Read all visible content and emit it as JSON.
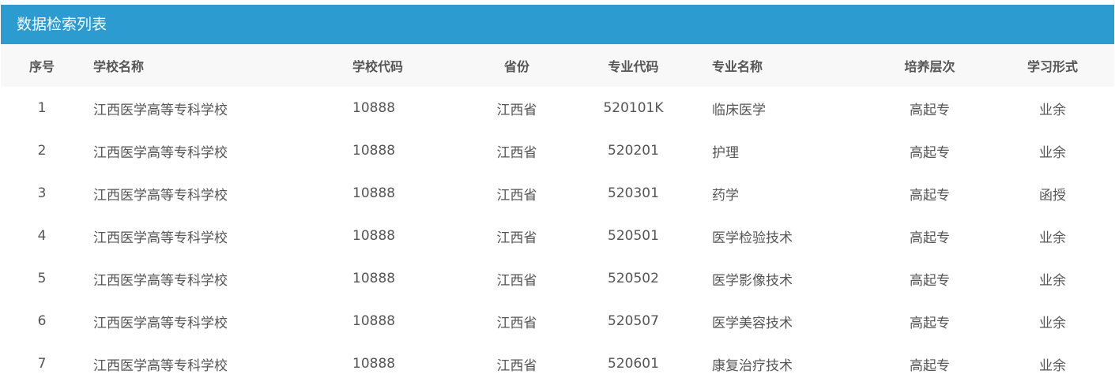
{
  "panel": {
    "title": "数据检索列表"
  },
  "columns": {
    "index": "序号",
    "school_name": "学校名称",
    "school_code": "学校代码",
    "province": "省份",
    "major_code": "专业代码",
    "major_name": "专业名称",
    "level": "培养层次",
    "study_form": "学习形式"
  },
  "rows": [
    {
      "index": "1",
      "school_name": "江西医学高等专科学校",
      "school_code": "10888",
      "province": "江西省",
      "major_code": "520101K",
      "major_name": "临床医学",
      "level": "高起专",
      "study_form": "业余"
    },
    {
      "index": "2",
      "school_name": "江西医学高等专科学校",
      "school_code": "10888",
      "province": "江西省",
      "major_code": "520201",
      "major_name": "护理",
      "level": "高起专",
      "study_form": "业余"
    },
    {
      "index": "3",
      "school_name": "江西医学高等专科学校",
      "school_code": "10888",
      "province": "江西省",
      "major_code": "520301",
      "major_name": "药学",
      "level": "高起专",
      "study_form": "函授"
    },
    {
      "index": "4",
      "school_name": "江西医学高等专科学校",
      "school_code": "10888",
      "province": "江西省",
      "major_code": "520501",
      "major_name": "医学检验技术",
      "level": "高起专",
      "study_form": "业余"
    },
    {
      "index": "5",
      "school_name": "江西医学高等专科学校",
      "school_code": "10888",
      "province": "江西省",
      "major_code": "520502",
      "major_name": "医学影像技术",
      "level": "高起专",
      "study_form": "业余"
    },
    {
      "index": "6",
      "school_name": "江西医学高等专科学校",
      "school_code": "10888",
      "province": "江西省",
      "major_code": "520507",
      "major_name": "医学美容技术",
      "level": "高起专",
      "study_form": "业余"
    },
    {
      "index": "7",
      "school_name": "江西医学高等专科学校",
      "school_code": "10888",
      "province": "江西省",
      "major_code": "520601",
      "major_name": "康复治疗技术",
      "level": "高起专",
      "study_form": "业余"
    }
  ],
  "colors": {
    "header_bg": "#2b9bd0",
    "table_head_bg": "#f8f8f8",
    "text": "#555555"
  }
}
